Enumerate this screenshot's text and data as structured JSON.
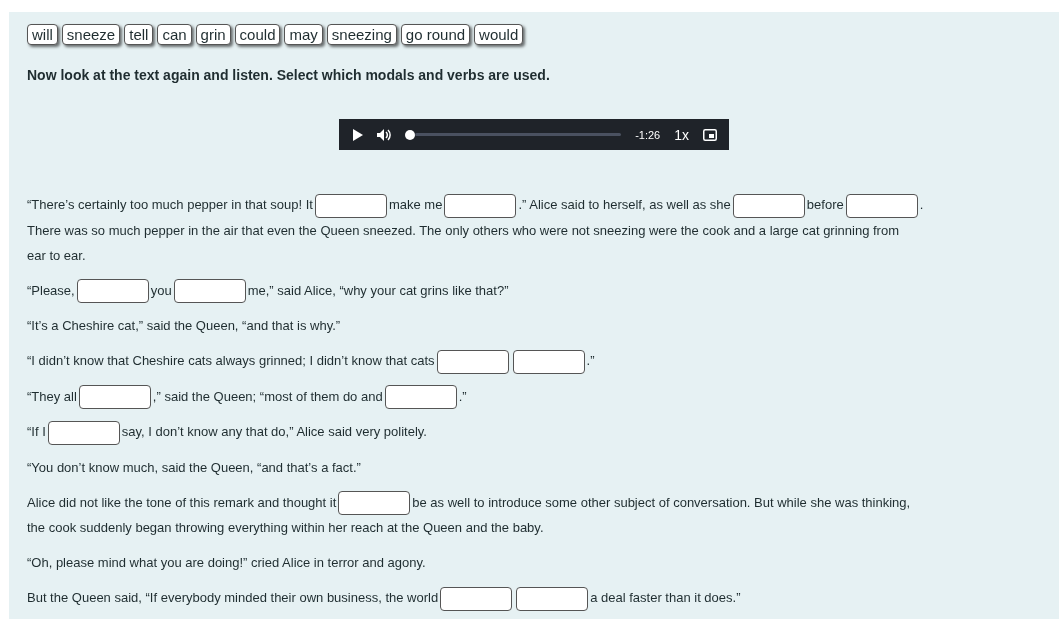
{
  "word_bank": [
    "will",
    "sneeze",
    "tell",
    "can",
    "grin",
    "could",
    "may",
    "sneezing",
    "go round",
    "would"
  ],
  "instruction": "Now look at the text again and listen. Select which modals and verbs are used.",
  "audio_player": {
    "level": 0,
    "time": "-1:26",
    "speed": "1x"
  },
  "paragraphs": [
    {
      "segments": [
        {
          "kind": "text",
          "text": "“There’s certainly too much pepper in that soup! It"
        },
        {
          "kind": "blank"
        },
        {
          "kind": "text",
          "text": "make me"
        },
        {
          "kind": "blank"
        },
        {
          "kind": "text",
          "text": ".” Alice said to herself, as well as she"
        },
        {
          "kind": "blank"
        },
        {
          "kind": "text",
          "text": "before"
        },
        {
          "kind": "blank"
        },
        {
          "kind": "text",
          "text": "."
        },
        {
          "kind": "line",
          "text": "There was so much pepper in the air that even the Queen sneezed. The only others who were not sneezing were the cook and a large cat grinning from"
        },
        {
          "kind": "line",
          "text": "ear to ear."
        }
      ]
    },
    {
      "segments": [
        {
          "kind": "text",
          "text": "“Please,"
        },
        {
          "kind": "blank"
        },
        {
          "kind": "text",
          "text": "you"
        },
        {
          "kind": "blank"
        },
        {
          "kind": "text",
          "text": "me,” said Alice, “why your cat grins like that?”"
        }
      ]
    },
    {
      "segments": [
        {
          "kind": "text",
          "text": "“It’s a Cheshire cat,” said the Queen, “and that is why.”"
        }
      ]
    },
    {
      "segments": [
        {
          "kind": "text",
          "text": "“I didn’t know that Cheshire cats always grinned; I didn’t know that cats"
        },
        {
          "kind": "blank"
        },
        {
          "kind": "blank"
        },
        {
          "kind": "text",
          "text": ".”"
        }
      ]
    },
    {
      "segments": [
        {
          "kind": "text",
          "text": "“They all"
        },
        {
          "kind": "blank"
        },
        {
          "kind": "text",
          "text": ",” said the Queen; “most of them do and"
        },
        {
          "kind": "blank"
        },
        {
          "kind": "text",
          "text": ".”"
        }
      ]
    },
    {
      "segments": [
        {
          "kind": "text",
          "text": "“If I"
        },
        {
          "kind": "blank"
        },
        {
          "kind": "text",
          "text": "say, I don’t know any that do,” Alice said very politely."
        }
      ]
    },
    {
      "segments": [
        {
          "kind": "text",
          "text": "“You don’t know much, said the Queen, “and that’s a fact.”"
        }
      ]
    },
    {
      "segments": [
        {
          "kind": "text",
          "text": "Alice did not like the tone of this remark and thought it"
        },
        {
          "kind": "blank"
        },
        {
          "kind": "text",
          "text": "be as well to introduce some other subject of conversation. But while she was thinking,"
        },
        {
          "kind": "line",
          "text": "the cook suddenly began throwing everything within her reach at the Queen and the baby."
        }
      ]
    },
    {
      "segments": [
        {
          "kind": "text",
          "text": "“Oh, please mind what you are doing!” cried Alice in terror and agony."
        }
      ]
    },
    {
      "segments": [
        {
          "kind": "text",
          "text": "But the Queen said, “If everybody minded their own business, the world"
        },
        {
          "kind": "blank"
        },
        {
          "kind": "blank"
        },
        {
          "kind": "text",
          "text": "a deal faster than it does.”"
        }
      ]
    }
  ]
}
